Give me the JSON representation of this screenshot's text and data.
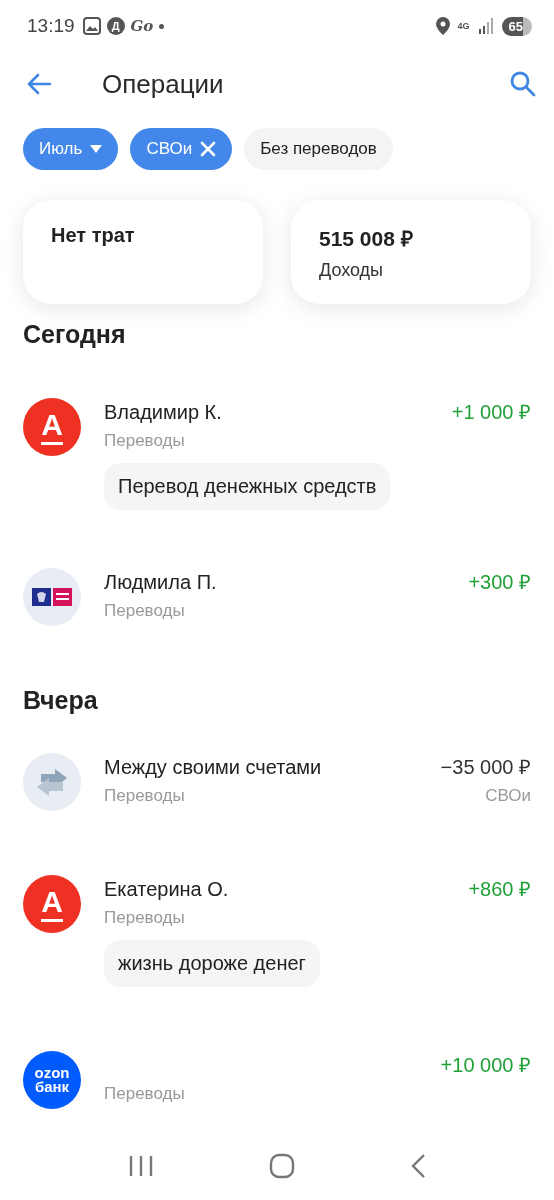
{
  "status_bar": {
    "time": "13:19",
    "notification_icons": [
      {
        "kind": "gallery"
      },
      {
        "kind": "badge",
        "text": "Д"
      },
      {
        "kind": "script",
        "text": "Go"
      }
    ],
    "network": "4G",
    "battery": "65"
  },
  "header": {
    "title": "Операции"
  },
  "filters": [
    {
      "label": "Июль",
      "selected": true,
      "kind": "dropdown"
    },
    {
      "label": "СВОи",
      "selected": true,
      "kind": "removable"
    },
    {
      "label": "Без переводов",
      "selected": false,
      "kind": "plain"
    }
  ],
  "summary": [
    {
      "title": "Нет трат"
    },
    {
      "amount": "515 008 ₽",
      "title": "Доходы"
    }
  ],
  "sections": [
    {
      "title": "Сегодня",
      "operations": [
        {
          "avatar": {
            "kind": "alfa",
            "text": "А"
          },
          "name": "Владимир К.",
          "category": "Переводы",
          "amount": "+1 000 ₽",
          "income": true,
          "note": "Перевод денежных средств"
        },
        {
          "avatar": {
            "kind": "pochta"
          },
          "name": "Людмила П.",
          "category": "Переводы",
          "amount": "+300 ₽",
          "income": true
        }
      ]
    },
    {
      "title": "Вчера",
      "operations": [
        {
          "avatar": {
            "kind": "transfer"
          },
          "name": "Между своими счетами",
          "category": "Переводы",
          "amount": "−35 000 ₽",
          "income": false,
          "account": "СВОи"
        },
        {
          "avatar": {
            "kind": "alfa",
            "text": "А"
          },
          "name": "Екатерина О.",
          "category": "Переводы",
          "amount": "+860 ₽",
          "income": true,
          "note": "жизнь дороже денег"
        },
        {
          "avatar": {
            "kind": "ozon",
            "lines": [
              "ozon",
              "банк"
            ]
          },
          "category": "Переводы",
          "amount": "+10 000 ₽",
          "income": true
        }
      ]
    }
  ]
}
